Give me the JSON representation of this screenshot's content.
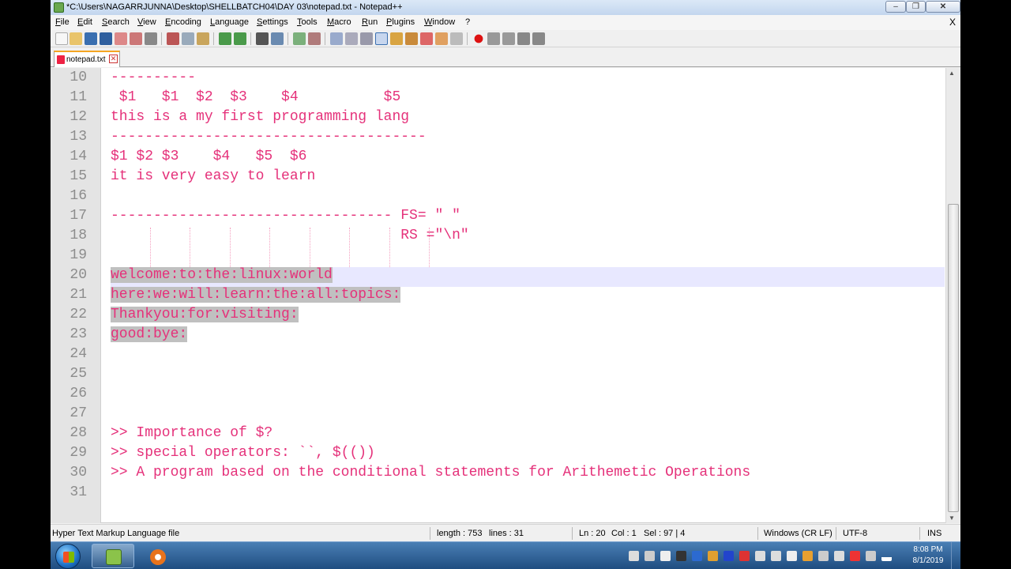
{
  "window": {
    "title": "*C:\\Users\\NAGARRJUNNA\\Desktop\\SHELLBATCH04\\DAY 03\\notepad.txt - Notepad++",
    "min": "‒",
    "max": "❐",
    "close": "✕"
  },
  "menu": [
    "File",
    "Edit",
    "Search",
    "View",
    "Encoding",
    "Language",
    "Settings",
    "Tools",
    "Macro",
    "Run",
    "Plugins",
    "Window",
    "?"
  ],
  "menu_close": "X",
  "tab": {
    "label": "notepad.txt",
    "close": "✕"
  },
  "editor": {
    "lines": [
      {
        "num": "10",
        "text": "----------"
      },
      {
        "num": "11",
        "text": " $1   $1  $2  $3    $4          $5"
      },
      {
        "num": "12",
        "text": "this is a my first programming lang"
      },
      {
        "num": "13",
        "text": "-------------------------------------"
      },
      {
        "num": "14",
        "text": "$1 $2 $3    $4   $5  $6"
      },
      {
        "num": "15",
        "text": "it is very easy to learn"
      },
      {
        "num": "16",
        "text": ""
      },
      {
        "num": "17",
        "text": "--------------------------------- FS= \" \""
      },
      {
        "num": "18",
        "text": "                                  RS =\"\\n\""
      },
      {
        "num": "19",
        "text": ""
      },
      {
        "num": "20",
        "text": "welcome:to:the:linux:world",
        "selected": true
      },
      {
        "num": "21",
        "text": "here:we:will:learn:the:all:topics:",
        "selected": true
      },
      {
        "num": "22",
        "text": "Thankyou:for:visiting:",
        "selected": true
      },
      {
        "num": "23",
        "text": "good:bye:",
        "selected": true
      },
      {
        "num": "24",
        "text": ""
      },
      {
        "num": "25",
        "text": ""
      },
      {
        "num": "26",
        "text": ""
      },
      {
        "num": "27",
        "text": ""
      },
      {
        "num": "28",
        "text": ">> Importance of $?"
      },
      {
        "num": "29",
        "text": ">> special operators: ``, $(())"
      },
      {
        "num": "30",
        "text": ">> A program based on the conditional statements for Arithemetic Operations"
      },
      {
        "num": "31",
        "text": ""
      }
    ]
  },
  "status": {
    "file_type": "Hyper Text Markup Language file",
    "length": "length : 753",
    "lines": "lines : 31",
    "ln": "Ln : 20",
    "col": "Col : 1",
    "sel": "Sel : 97 | 4",
    "eol": "Windows (CR LF)",
    "encoding": "UTF-8",
    "mode": "INS"
  },
  "taskbar": {
    "time": "8:08 PM",
    "date": "8/1/2019"
  },
  "colors": {
    "code_text": "#e5317a",
    "selection": "#c0c0c0",
    "current_line": "#e8e8ff",
    "tab_accent": "#f5a623"
  }
}
